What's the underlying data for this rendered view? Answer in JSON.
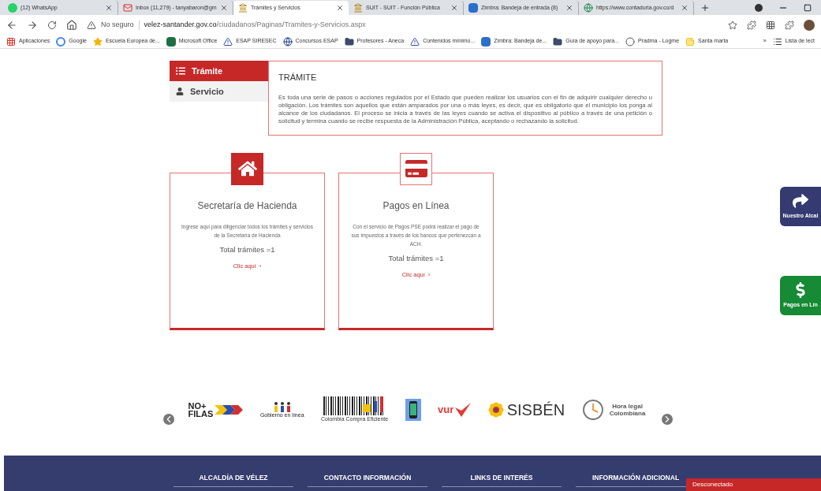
{
  "browser": {
    "tabs": [
      {
        "title": "(12) WhatsApp",
        "selected": false
      },
      {
        "title": "Inbox (11,279) - tanyabaron@gm",
        "selected": false
      },
      {
        "title": "Trámites y Servicios",
        "selected": true
      },
      {
        "title": "SUIT - SUIT - Función Pública",
        "selected": false
      },
      {
        "title": "Zimbra: Bandeja de entrada (8)",
        "selected": false
      },
      {
        "title": "https://www.contaduria.gov.co/d",
        "selected": false
      }
    ],
    "security": "No seguro",
    "url_host": "velez-santander.gov.co",
    "url_path": "/ciudadanos/Paginas/Tramites-y-Servicios.aspx",
    "bookmarks": [
      {
        "label": "Aplicaciones"
      },
      {
        "label": "Google"
      },
      {
        "label": "Escuela Europea de..."
      },
      {
        "label": "Microsoft Office"
      },
      {
        "label": "ESAP SIRESEC"
      },
      {
        "label": "Concursos ESAP"
      },
      {
        "label": "Profesores - Aneca"
      },
      {
        "label": "Contenidos mínimo..."
      },
      {
        "label": "Zimbra: Bandeja de..."
      },
      {
        "label": "Guía de apoyo para..."
      },
      {
        "label": "Pradma - Logme"
      },
      {
        "label": "Santa marta"
      }
    ],
    "more": "»",
    "reading_list": "Lista de lect"
  },
  "side_tabs": [
    {
      "label": "Trámite",
      "selected": true
    },
    {
      "label": "Servicio",
      "selected": false
    }
  ],
  "description": {
    "title": "TRÁMITE",
    "text": "Es toda una serie de pasos o acciones regulados por el Estado que pueden realizar los usuarios con el fin de adquirir cualquier derecho u obligación. Los trámites son aquellos que están amparados por una o más leyes, es decir, que es obligatorio que el municipio los ponga al alcance de los ciudadanos. El proceso se inicia a través de las leyes cuando se activa el dispositivo al público a través de una petición o solicitud y termina cuando se recibe respuesta de la Administración Pública, aceptando o rechazando la solicitud."
  },
  "cards": [
    {
      "filled": true,
      "title": "Secretaría de Hacienda",
      "text": "Ingrese aquí para diligenciar todos los trámites y servicios de la Secretaría de Hacienda",
      "total": "Total trámites =1",
      "link": "Clic aquí",
      "chevron": "›"
    },
    {
      "filled": false,
      "title": "Pagos en Línea",
      "text": "Con el servicio de Pagos  PSE podrá realizar el pago de sus impuestos  a través de los bancos que pertenezcan a ACH.",
      "total": "Total trámites =1",
      "link": "Clic aquí",
      "chevron": "›"
    }
  ],
  "float_buttons": [
    {
      "label": "Nuestro Alcal",
      "color": "#353b70"
    },
    {
      "label": "Pagos en Lín",
      "color": "#168a35"
    }
  ],
  "logos": [
    {
      "kind": "nofilas",
      "text": "NO+ FILAS"
    },
    {
      "kind": "gel",
      "text": "Gobierno en línea"
    },
    {
      "kind": "barcode",
      "text": "Colombia Compra Eficiente"
    },
    {
      "kind": "phone"
    },
    {
      "kind": "vur",
      "text": "vur"
    },
    {
      "kind": "sisben",
      "text": "SISBÉN"
    },
    {
      "kind": "clock",
      "text": "Hora legal Colombiana"
    }
  ],
  "footer": {
    "columns": [
      "ALCALDÍA DE VÉLEZ",
      "CONTACTO INFORMACIÓN",
      "LINKS DE INTERÉS",
      "INFORMACIÓN ADICIONAL"
    ],
    "status": "Desconectado"
  }
}
